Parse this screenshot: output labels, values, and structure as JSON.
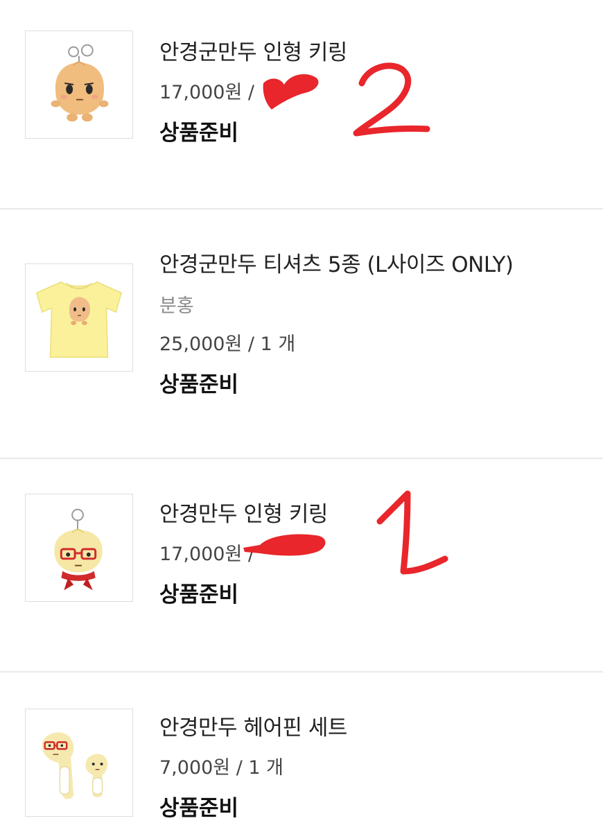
{
  "items": [
    {
      "name": "안경군만두 인형 키링",
      "option": "",
      "price": "17,000원 / ",
      "status": "상품준비",
      "image_icon": "keyring-dumpling-icon",
      "annotation_number": "2"
    },
    {
      "name": "안경군만두 티셔츠 5종 (L사이즈 ONLY)",
      "option": "분홍",
      "price": "25,000원 / 1 개",
      "status": "상품준비",
      "image_icon": "yellow-tshirt-icon"
    },
    {
      "name": "안경만두 인형 키링",
      "option": "",
      "price": "17,000원 / ",
      "status": "상품준비",
      "image_icon": "keyring-glasses-dumpling-icon",
      "annotation_number": "1"
    },
    {
      "name": "안경만두 헤어핀 세트",
      "option": "",
      "price": "7,000원 / 1 개",
      "status": "상품준비",
      "image_icon": "hairpin-set-icon"
    }
  ],
  "colors": {
    "annotation_red": "#e8262b",
    "divider": "#e9e9e9",
    "tshirt_yellow": "#fbf19a"
  }
}
